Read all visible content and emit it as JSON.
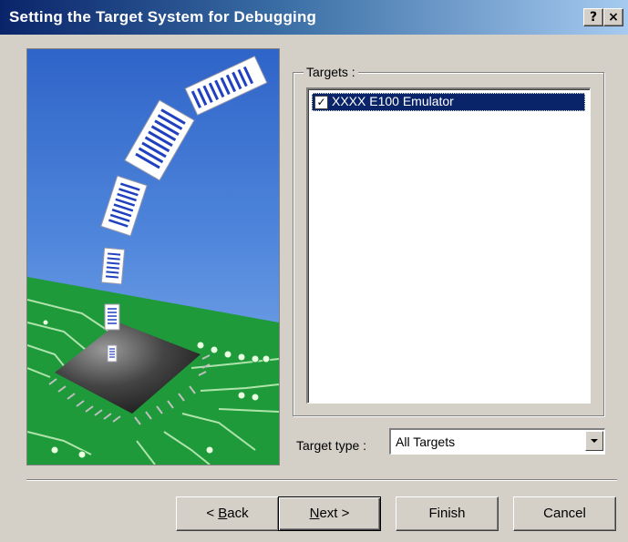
{
  "window": {
    "title": "Setting the Target System for Debugging",
    "help_glyph": "?",
    "close_glyph": "×"
  },
  "targets": {
    "group_label": "Targets :",
    "items": [
      {
        "label": "XXXX E100 Emulator",
        "checked": true,
        "selected": true
      }
    ]
  },
  "target_type": {
    "label": "Target type :",
    "selected": "All Targets"
  },
  "buttons": {
    "back": {
      "mnemonic": "B",
      "rest": "ack",
      "prefix": "< "
    },
    "next": {
      "mnemonic": "N",
      "rest": "ext >"
    },
    "finish": "Finish",
    "cancel": "Cancel"
  }
}
